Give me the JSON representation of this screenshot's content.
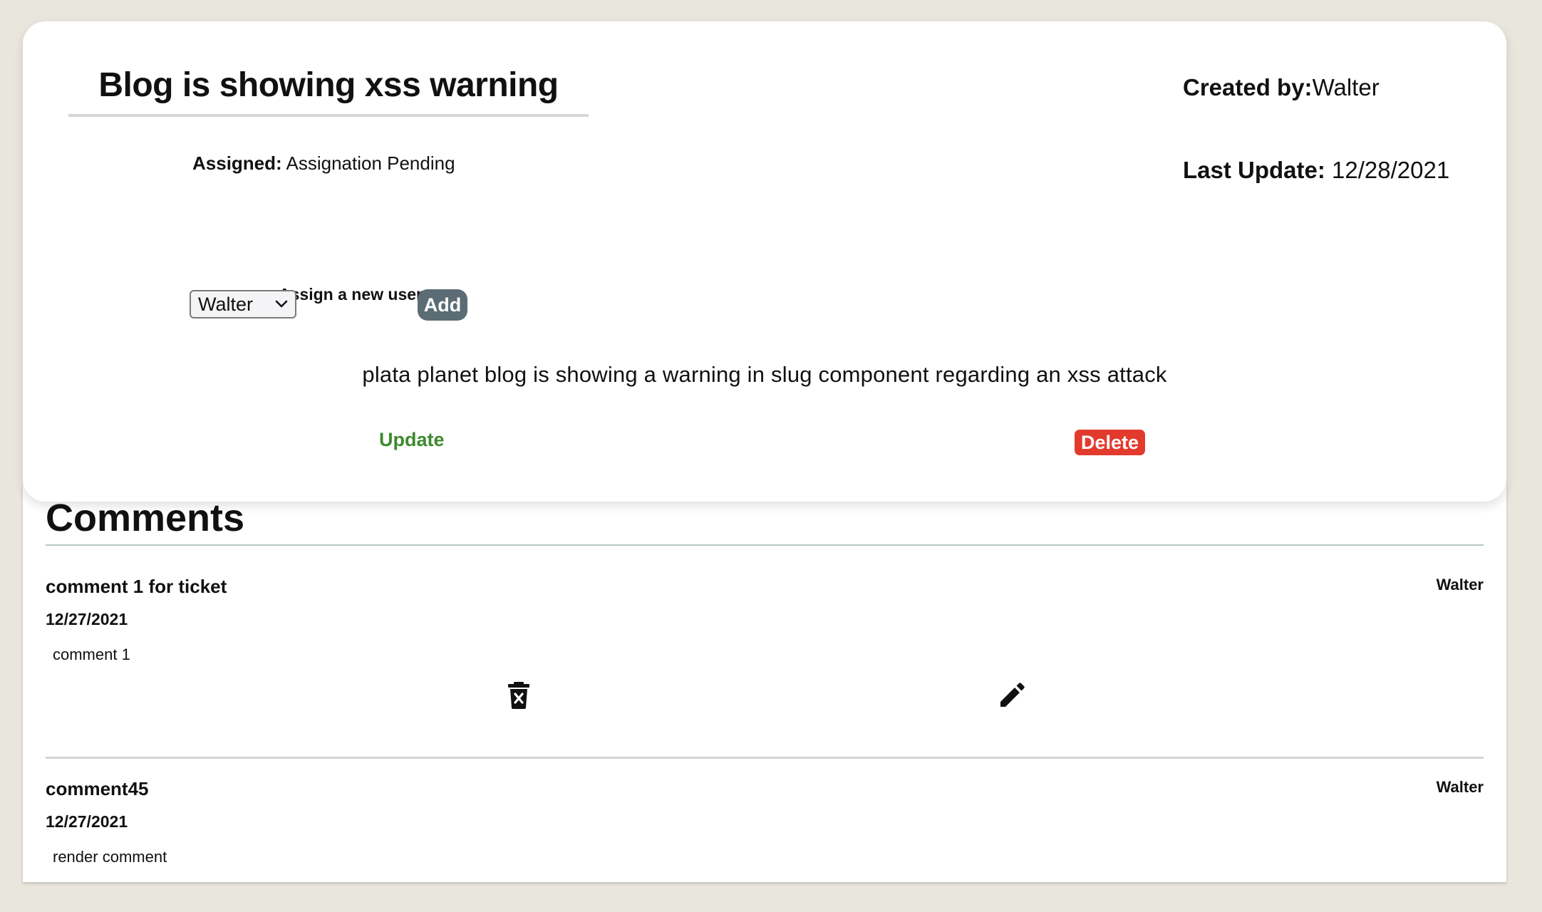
{
  "ticket": {
    "title": "Blog is showing xss warning",
    "assigned_label": "Assigned:",
    "assigned_value": "Assignation Pending",
    "created_by_label": "Created by:",
    "created_by_value": "Walter",
    "last_update_label": "Last Update:",
    "last_update_value": "12/28/2021",
    "assign_new_user_label": "Assign a new user",
    "user_select_value": "Walter",
    "add_label": "Add",
    "description": "plata planet blog is showing a warning in slug component regarding an xss attack",
    "update_label": "Update",
    "delete_label": "Delete"
  },
  "comments": {
    "title": "Comments",
    "items": [
      {
        "title": "comment 1 for ticket",
        "author": "Walter",
        "date": "12/27/2021",
        "body": "comment 1"
      },
      {
        "title": "comment45",
        "author": "Walter",
        "date": "12/27/2021",
        "body": "render comment"
      }
    ]
  },
  "icons": {
    "comment_delete": "trash-x-icon",
    "comment_edit": "pencil-icon",
    "select_chevron": "chevron-down-icon"
  },
  "colors": {
    "page_background": "#e9e6dd",
    "add_button": "#5b6c75",
    "update_text": "#3e8a2e",
    "delete_button": "#e33a2e"
  }
}
